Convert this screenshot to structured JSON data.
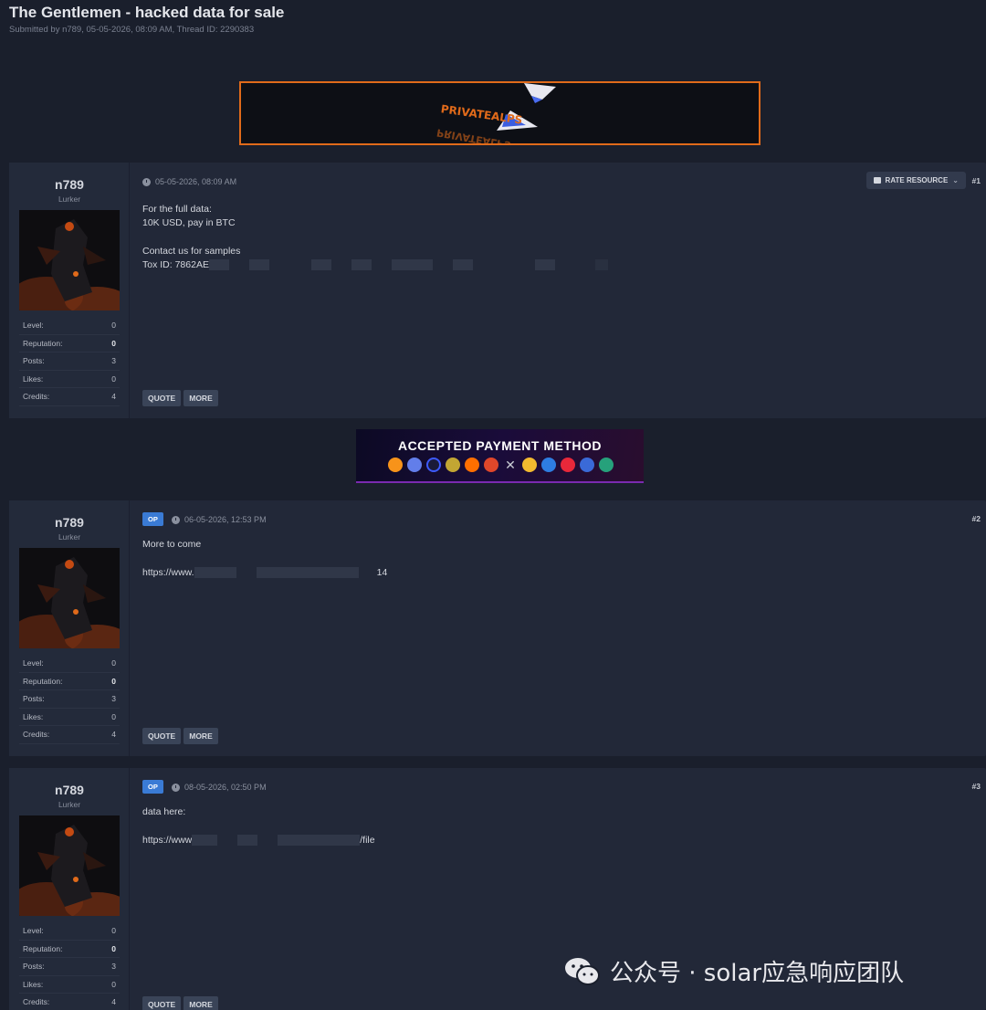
{
  "thread": {
    "title": "The Gentlemen - hacked data for sale",
    "meta": "Submitted by n789, 05-05-2026, 08:09 AM, Thread ID: 2290383"
  },
  "banner": {
    "logo_text": "PRIVATEALPS"
  },
  "payment_banner": {
    "title": "ACCEPTED PAYMENT METHOD",
    "coins": [
      "#f7931a",
      "#627eea",
      "#3d5afe",
      "#c2a633",
      "#ff6f00",
      "#e0472a",
      "#9aa0a8",
      "#f3ba2f",
      "#2e7de1",
      "#e8283a",
      "#3a6ad8",
      "#26a17b"
    ]
  },
  "user": {
    "name": "n789",
    "title": "Lurker",
    "stats": [
      {
        "label": "Level:",
        "value": "0"
      },
      {
        "label": "Reputation:",
        "value": "0"
      },
      {
        "label": "Posts:",
        "value": "3"
      },
      {
        "label": "Likes:",
        "value": "0"
      },
      {
        "label": "Credits:",
        "value": "4"
      }
    ]
  },
  "buttons": {
    "quote": "QUOTE",
    "more": "MORE",
    "rate": "RATE RESOURCE",
    "op": "OP"
  },
  "posts": [
    {
      "date": "05-05-2026, 08:09 AM",
      "number": "#1",
      "lines": [
        "For the full data:",
        "10K USD, pay in BTC",
        "",
        "Contact us for samples",
        "Tox ID: 7862AE"
      ]
    },
    {
      "date": "06-05-2026, 12:53 PM",
      "number": "#2",
      "lines": [
        "More to come",
        "",
        "https://www.",
        "14"
      ]
    },
    {
      "date": "08-05-2026, 02:50 PM",
      "number": "#3",
      "lines": [
        "data here:",
        "",
        "https://www",
        "/file"
      ]
    }
  ],
  "watermark": {
    "text": "公众号 · solar应急响应团队"
  }
}
